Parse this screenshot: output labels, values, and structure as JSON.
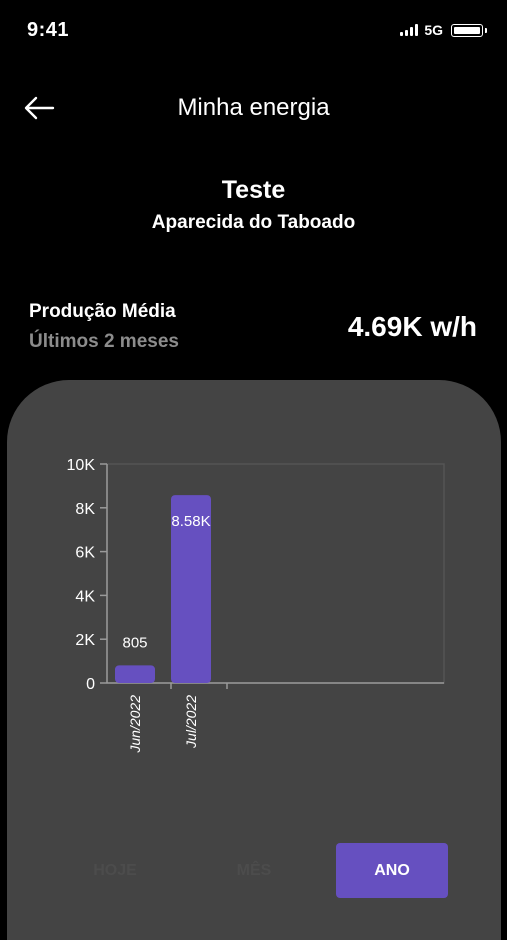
{
  "status_bar": {
    "time": "9:41",
    "network": "5G"
  },
  "header": {
    "title": "Minha energia"
  },
  "site": {
    "name": "Teste",
    "city": "Aparecida do Taboado"
  },
  "production": {
    "label": "Produção Média",
    "period": "Últimos 2 meses",
    "value": "4.69K w/h"
  },
  "tabs": [
    {
      "label": "HOJE",
      "active": false
    },
    {
      "label": "MÊS",
      "active": false
    },
    {
      "label": "ANO",
      "active": true
    }
  ],
  "colors": {
    "accent": "#6650c0",
    "card": "#444444",
    "background": "#000000"
  },
  "chart_data": {
    "type": "bar",
    "categories": [
      "Jun/2022",
      "Jul/2022"
    ],
    "values": [
      805,
      8580
    ],
    "data_labels": [
      "805",
      "8.58K"
    ],
    "ylim": [
      0,
      10000
    ],
    "y_ticks": [
      0,
      2000,
      4000,
      6000,
      8000,
      10000
    ],
    "y_tick_labels": [
      "0",
      "2K",
      "4K",
      "6K",
      "8K",
      "10K"
    ],
    "xlabel": "",
    "ylabel": "",
    "grid": false,
    "bar_color": "#6650c0"
  }
}
